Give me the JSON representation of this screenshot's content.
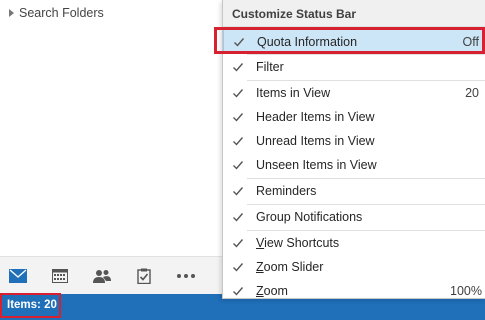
{
  "folder_pane": {
    "search_folders_label": "Search Folders"
  },
  "navigation": {
    "items": [
      {
        "name": "mail-icon",
        "color": "#1f6fb9"
      },
      {
        "name": "calendar-icon"
      },
      {
        "name": "people-icon"
      },
      {
        "name": "tasks-icon"
      },
      {
        "name": "more-icon"
      }
    ]
  },
  "status_bar": {
    "items_text": "Items: 20",
    "background": "#1f6fb9"
  },
  "menu": {
    "title": "Customize Status Bar",
    "items": [
      {
        "label": "Quota Information",
        "value": "Off",
        "checked": true,
        "selected": true
      },
      {
        "label": "Filter",
        "value": "",
        "checked": true
      },
      {
        "label": "Items in View",
        "value": "20",
        "checked": true
      },
      {
        "label": "Header Items in View",
        "value": "",
        "checked": true
      },
      {
        "label": "Unread Items in View",
        "value": "",
        "checked": true
      },
      {
        "label": "Unseen Items in View",
        "value": "",
        "checked": true
      },
      {
        "label": "Reminders",
        "value": "",
        "checked": true
      },
      {
        "label": "Group Notifications",
        "value": "",
        "checked": true
      },
      {
        "label_pre": "",
        "label_ul": "V",
        "label_post": "iew Shortcuts",
        "checked": true
      },
      {
        "label_pre": "",
        "label_ul": "Z",
        "label_post": "oom Slider",
        "checked": true
      },
      {
        "label_pre": "",
        "label_ul": "Z",
        "label_post": "oom",
        "value": "100%",
        "checked": true
      }
    ]
  },
  "highlight_color": "#d72030"
}
